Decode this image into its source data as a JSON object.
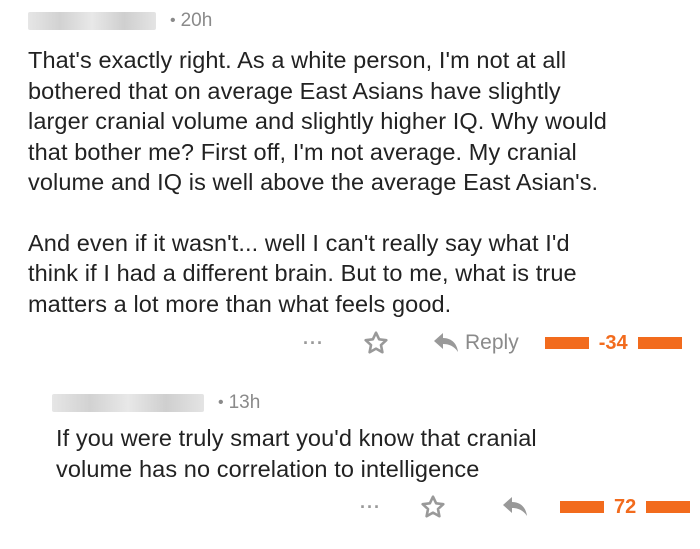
{
  "comments": [
    {
      "age": "20h",
      "paragraphs": [
        "That's exactly right. As a white person, I'm not at all\nbothered that on average East Asians have slightly\nlarger cranial volume and slightly higher IQ. Why would\nthat bother me? First off, I'm not average. My cranial\nvolume and IQ is well above the average East Asian's.",
        "And even if it wasn't... well I can't really say what I'd\nthink if I had a different brain. But to me, what is true\nmatters a lot more than what feels good."
      ],
      "more_label": "···",
      "reply_label": "Reply",
      "score": "-34",
      "accent_color": "#f26b1d",
      "icons": [
        "star-icon",
        "reply-arrow-icon"
      ]
    },
    {
      "age": "13h",
      "paragraphs": [
        "If you were truly smart you'd know that cranial\nvolume has no correlation to intelligence"
      ],
      "more_label": "···",
      "reply_label": "",
      "score": "72",
      "accent_color": "#f26b1d",
      "icons": [
        "star-icon",
        "reply-arrow-icon"
      ]
    }
  ],
  "meta_separator": "•"
}
